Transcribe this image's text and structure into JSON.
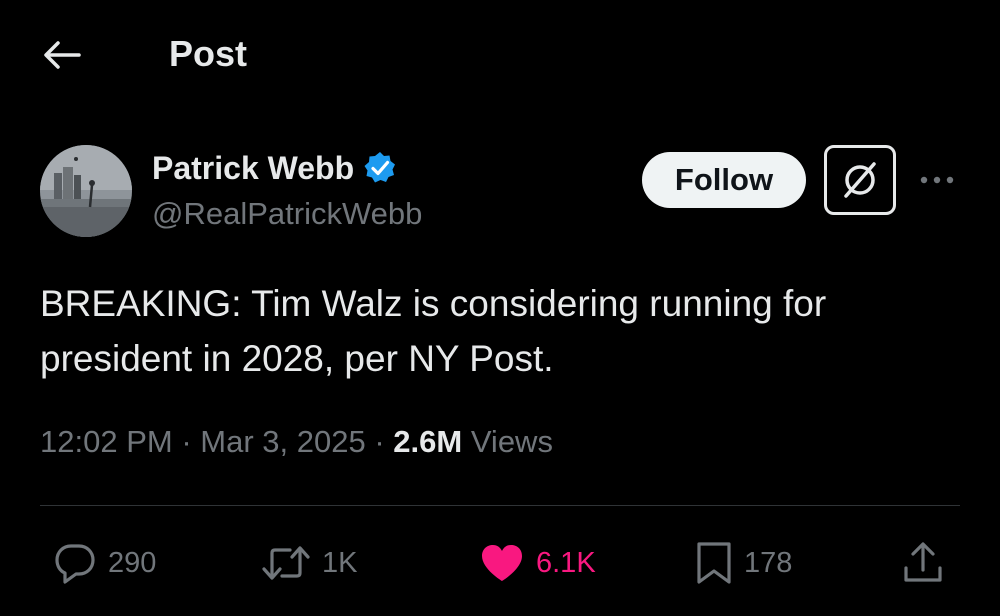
{
  "header": {
    "title": "Post",
    "back_icon": "arrow-left-icon"
  },
  "author": {
    "display_name": "Patrick Webb",
    "handle": "@RealPatrickWebb",
    "verified": true,
    "verified_color": "#1d9bf0",
    "avatar_icon": "profile-photo"
  },
  "actions_top": {
    "follow_label": "Follow",
    "grok_icon": "grok-icon",
    "more_icon": "more-dots-icon"
  },
  "post": {
    "text": "BREAKING: Tim Walz is considering running for president in 2028, per NY Post.",
    "time": "12:02 PM",
    "date": "Mar 3, 2025",
    "views_count": "2.6M",
    "views_label": "Views"
  },
  "engagement": {
    "replies": "290",
    "reposts": "1K",
    "likes": "6.1K",
    "bookmarks": "178",
    "like_color": "#f91880"
  },
  "colors": {
    "background": "#000000",
    "primary_text": "#e7e9ea",
    "secondary_text": "#71767b",
    "divider": "#2f3336"
  }
}
